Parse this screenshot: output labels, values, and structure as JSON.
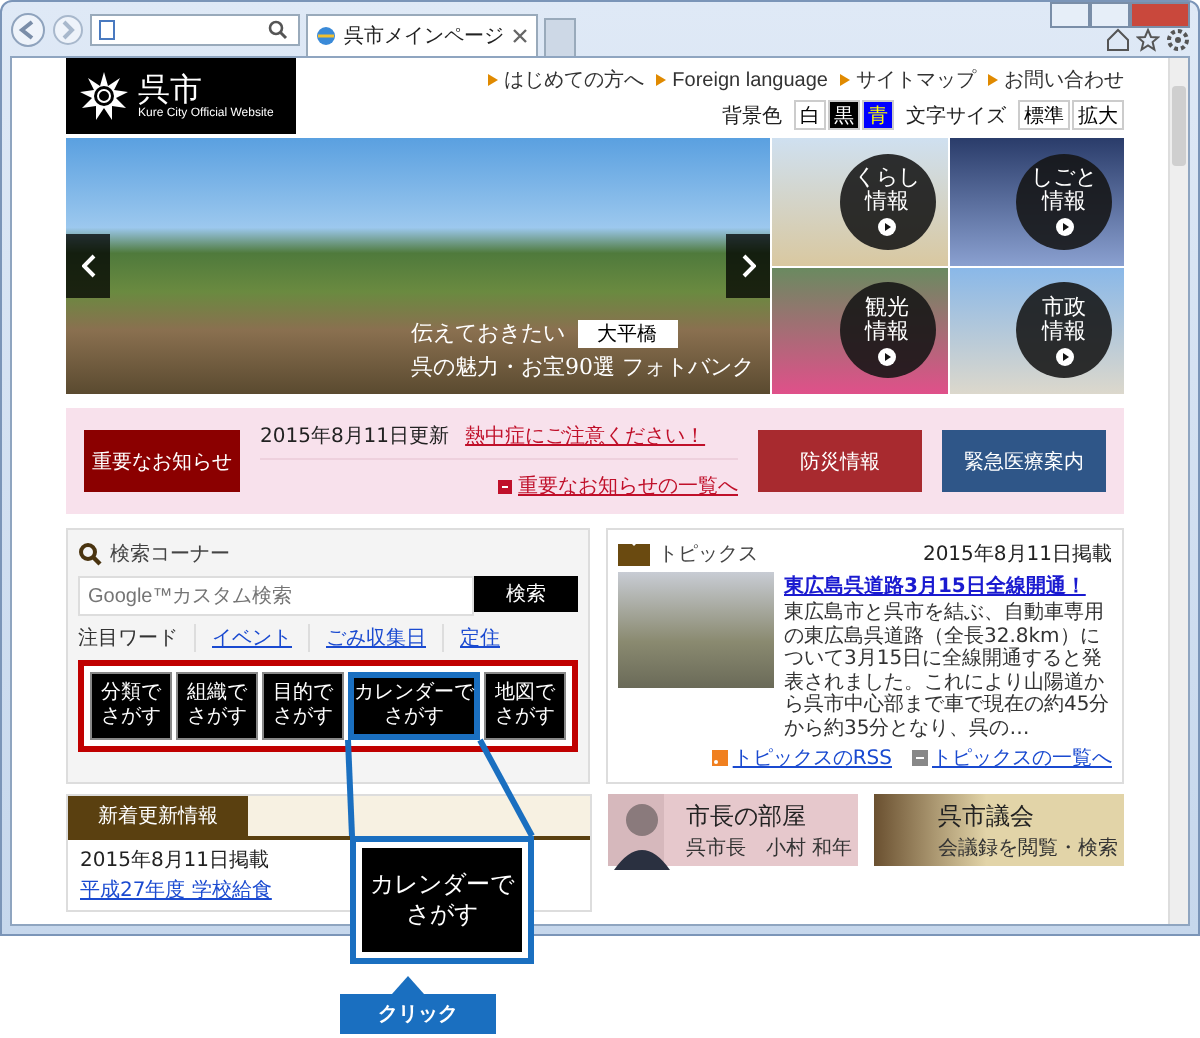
{
  "browser": {
    "tab_title": "呉市メインページ"
  },
  "header": {
    "logo_title": "呉市",
    "logo_subtitle": "Kure City Official Website",
    "nav_links": [
      "はじめての方へ",
      "Foreign language",
      "サイトマップ",
      "お問い合わせ"
    ],
    "bg_color_label": "背景色",
    "bg_color_options": [
      {
        "label": "白",
        "color": "#ffffff"
      },
      {
        "label": "黒",
        "color": "#000000"
      },
      {
        "label": "青",
        "color": "#0000ff"
      }
    ],
    "font_size_label": "文字サイズ",
    "font_size_buttons": [
      "標準",
      "拡大"
    ]
  },
  "slideshow": {
    "caption_lines": [
      "伝えておきたい",
      "呉の魅力・お宝90選 フォトバンク"
    ],
    "photo_label": "大平橋"
  },
  "category_tiles": [
    {
      "lines": [
        "くらし",
        "情報"
      ]
    },
    {
      "lines": [
        "しごと",
        "情報"
      ]
    },
    {
      "lines": [
        "観光",
        "情報"
      ]
    },
    {
      "lines": [
        "市政",
        "情報"
      ]
    }
  ],
  "notices": {
    "heading": "重要なお知らせ",
    "items": [
      {
        "date": "2015年8月11日更新",
        "link": "熱中症にご注意ください！"
      }
    ],
    "more_link": "重要なお知らせの一覧へ",
    "buttons": [
      {
        "label": "防災情報",
        "color": "#a82a2f"
      },
      {
        "label": "緊急医療案内",
        "color": "#2f5688"
      }
    ]
  },
  "search": {
    "title": "検索コーナー",
    "placeholder": "Google™カスタム検索",
    "button": "検索",
    "featured_label": "注目ワード",
    "featured_links": [
      "イベント",
      "ごみ収集日",
      "定住"
    ],
    "search_buttons": [
      {
        "lines": [
          "分類で",
          "さがす"
        ],
        "highlighted": false
      },
      {
        "lines": [
          "組織で",
          "さがす"
        ],
        "highlighted": false
      },
      {
        "lines": [
          "目的で",
          "さがす"
        ],
        "highlighted": false
      },
      {
        "lines": [
          "カレンダーで",
          "さがす"
        ],
        "highlighted": true
      },
      {
        "lines": [
          "地図で",
          "さがす"
        ],
        "highlighted": false
      }
    ]
  },
  "topics": {
    "title": "トピックス",
    "date": "2015年8月11日掲載",
    "headline": "東広島呉道路3月15日全線開通！",
    "body": "東広島市と呉市を結ぶ、自動車専用の東広島呉道路（全長32.8km）について3月15日に全線開通すると発表されました。これにより山陽道から呉市中心部まで車で現在の約45分から約35分となり、呉の…",
    "links": [
      "トピックスのRSS",
      "トピックスの一覧へ"
    ]
  },
  "news": {
    "tab": "新着更新情報",
    "items": [
      {
        "date": "2015年8月11日掲載",
        "link": "平成27年度 学校給食"
      }
    ]
  },
  "banners": [
    {
      "title": "市長の部屋",
      "subtitle": "呉市長　小村 和年"
    },
    {
      "title": "呉市議会",
      "subtitle": "会議録を閲覧・検索"
    }
  ],
  "callout": {
    "button_lines": [
      "カレンダーで",
      "さがす"
    ],
    "label": "クリック"
  }
}
